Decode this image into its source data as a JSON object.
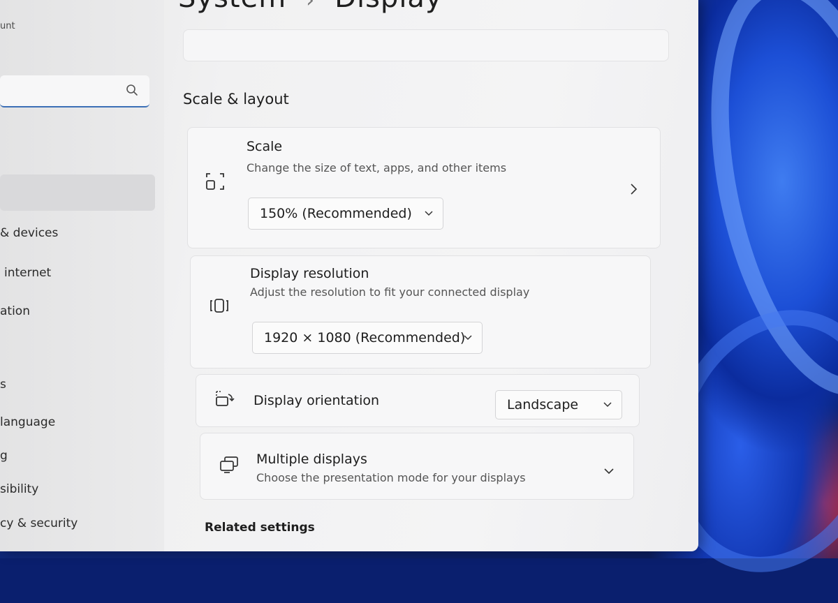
{
  "sidebar": {
    "account_text": "unt",
    "search": {
      "placeholder": ""
    },
    "items": [
      {
        "label": "& devices"
      },
      {
        "label": "internet"
      },
      {
        "label": "ation"
      },
      {
        "label": "s"
      },
      {
        "label": "language"
      },
      {
        "label": "g"
      },
      {
        "label": "sibility"
      },
      {
        "label": "cy & security"
      }
    ]
  },
  "header": {
    "breadcrumb_parent": "System",
    "breadcrumb_separator": "›",
    "breadcrumb_current": "Display"
  },
  "section": {
    "title": "Scale & layout"
  },
  "scale": {
    "title": "Scale",
    "subtitle": "Change the size of text, apps, and other items",
    "value": "150% (Recommended)",
    "icon": "scale-icon"
  },
  "resolution": {
    "title": "Display resolution",
    "subtitle": "Adjust the resolution to fit your connected display",
    "value": "1920 × 1080 (Recommended)",
    "icon": "resolution-icon"
  },
  "orientation": {
    "title": "Display orientation",
    "value": "Landscape",
    "icon": "orientation-icon"
  },
  "multiple": {
    "title": "Multiple displays",
    "subtitle": "Choose the presentation mode for your displays",
    "icon": "multiple-displays-icon"
  },
  "related": {
    "title": "Related settings"
  },
  "colors": {
    "accent": "#3b6fb6",
    "card_bg": "#f7f7f8",
    "window_bg": "#f2f2f3"
  }
}
